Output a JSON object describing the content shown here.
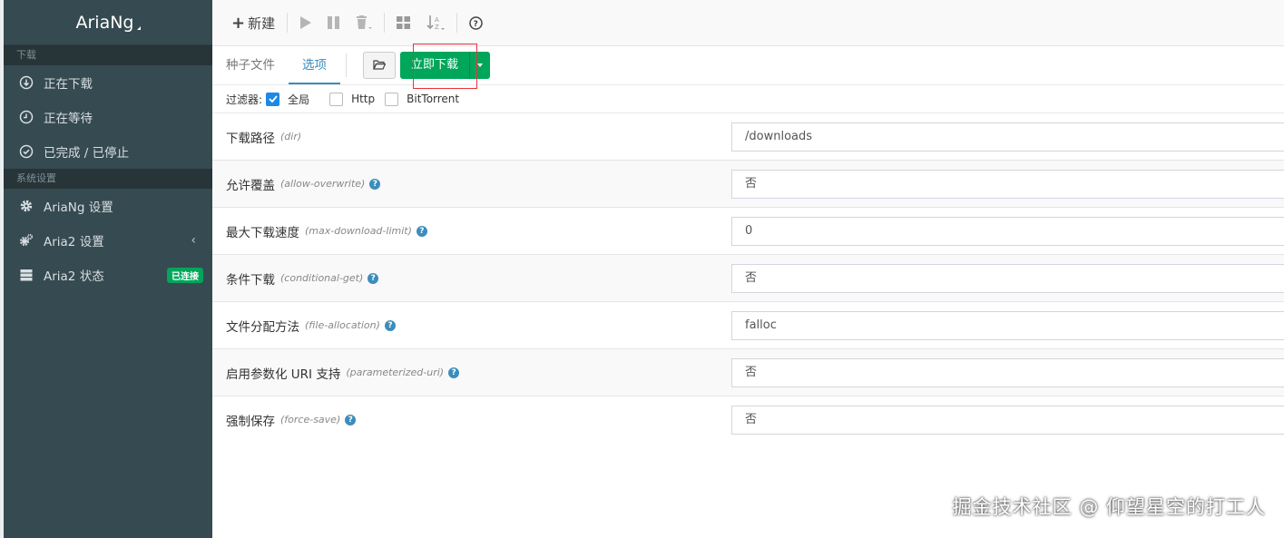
{
  "app": {
    "title": "AriaNg"
  },
  "sidebar": {
    "section_download": "下载",
    "downloading": "正在下载",
    "waiting": "正在等待",
    "stopped": "已完成 / 已停止",
    "section_settings": "系统设置",
    "ariang_settings": "AriaNg 设置",
    "aria2_settings": "Aria2 设置",
    "aria2_status": "Aria2 状态",
    "status_badge": "已连接"
  },
  "toolbar": {
    "new_label": "新建"
  },
  "tabs": {
    "torrent": "种子文件",
    "options": "选项"
  },
  "download_now": "立即下载",
  "filter": {
    "label": "过滤器:",
    "all": "全局",
    "http": "Http",
    "bittorrent": "BitTorrent",
    "all_checked": true
  },
  "options": [
    {
      "label": "下载路径",
      "key": "(dir)",
      "value": "/downloads",
      "help": false
    },
    {
      "label": "允许覆盖",
      "key": "(allow-overwrite)",
      "value": "否",
      "help": true
    },
    {
      "label": "最大下载速度",
      "key": "(max-download-limit)",
      "value": "0",
      "help": true
    },
    {
      "label": "条件下载",
      "key": "(conditional-get)",
      "value": "否",
      "help": true
    },
    {
      "label": "文件分配方法",
      "key": "(file-allocation)",
      "value": "falloc",
      "help": true
    },
    {
      "label": "启用参数化 URI 支持",
      "key": "(parameterized-uri)",
      "value": "否",
      "help": true
    },
    {
      "label": "强制保存",
      "key": "(force-save)",
      "value": "否",
      "help": true
    }
  ],
  "watermark": "掘金技术社区 @ 仰望星空的打工人",
  "colors": {
    "sidebar_bg": "#364a51",
    "accent": "#3c8dbc",
    "success": "#00a65a",
    "highlight_box": "#e8333a"
  }
}
